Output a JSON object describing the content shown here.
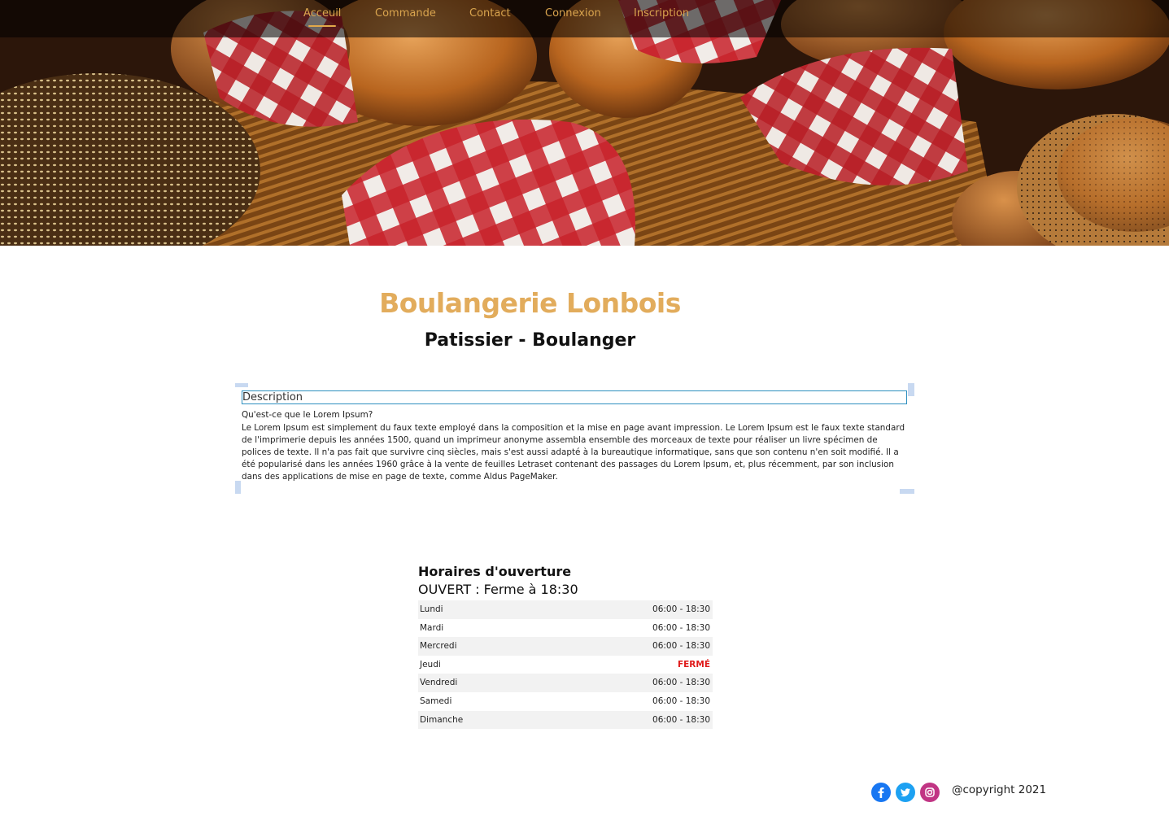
{
  "nav": {
    "items": [
      {
        "label": "Acceuil",
        "active": true
      },
      {
        "label": "Commande",
        "active": false
      },
      {
        "label": "Contact",
        "active": false
      },
      {
        "label": "Connexion",
        "active": false
      },
      {
        "label": "Inscription",
        "active": false
      }
    ]
  },
  "colors": {
    "accent": "#e2ac5c",
    "nav_text": "#d9a44e",
    "closed": "#e01b1b",
    "input_border": "#2d8fbf"
  },
  "header": {
    "title": "Boulangerie Lonbois",
    "subtitle": "Patissier - Boulanger"
  },
  "description": {
    "field_value": "Description",
    "question": "Qu'est-ce que le Lorem Ipsum?",
    "body": "Le Lorem Ipsum est simplement du faux texte employé dans la composition et la mise en page avant impression. Le Lorem Ipsum est le faux texte standard de l'imprimerie depuis les années 1500, quand un imprimeur anonyme assembla ensemble des morceaux de texte pour réaliser un livre spécimen de polices de texte. Il n'a pas fait que survivre cinq siècles, mais s'est aussi adapté à la bureautique informatique, sans que son contenu n'en soit modifié. Il a été popularisé dans les années 1960 grâce à la vente de feuilles Letraset contenant des passages du Lorem Ipsum, et, plus récemment, par son inclusion dans des applications de mise en page de texte, comme Aldus PageMaker."
  },
  "hours": {
    "title": "Horaires d'ouverture",
    "status": "OUVERT : Ferme à 18:30",
    "rows": [
      {
        "day": "Lundi",
        "time": "06:00 - 18:30"
      },
      {
        "day": "Mardi",
        "time": "06:00 - 18:30"
      },
      {
        "day": "Mercredi",
        "time": "06:00 - 18:30"
      },
      {
        "day": "Jeudi",
        "time": "FERMÉ"
      },
      {
        "day": "Vendredi",
        "time": "06:00 - 18:30"
      },
      {
        "day": "Samedi",
        "time": "06:00 - 18:30"
      },
      {
        "day": "Dimanche",
        "time": "06:00 - 18:30"
      }
    ]
  },
  "footer": {
    "social": [
      {
        "icon": "facebook-icon",
        "color": "#1877f2"
      },
      {
        "icon": "twitter-icon",
        "color": "#1da1f2"
      },
      {
        "icon": "instagram-icon",
        "color": "#c13584"
      }
    ],
    "copyright": "@copyright 2021"
  }
}
